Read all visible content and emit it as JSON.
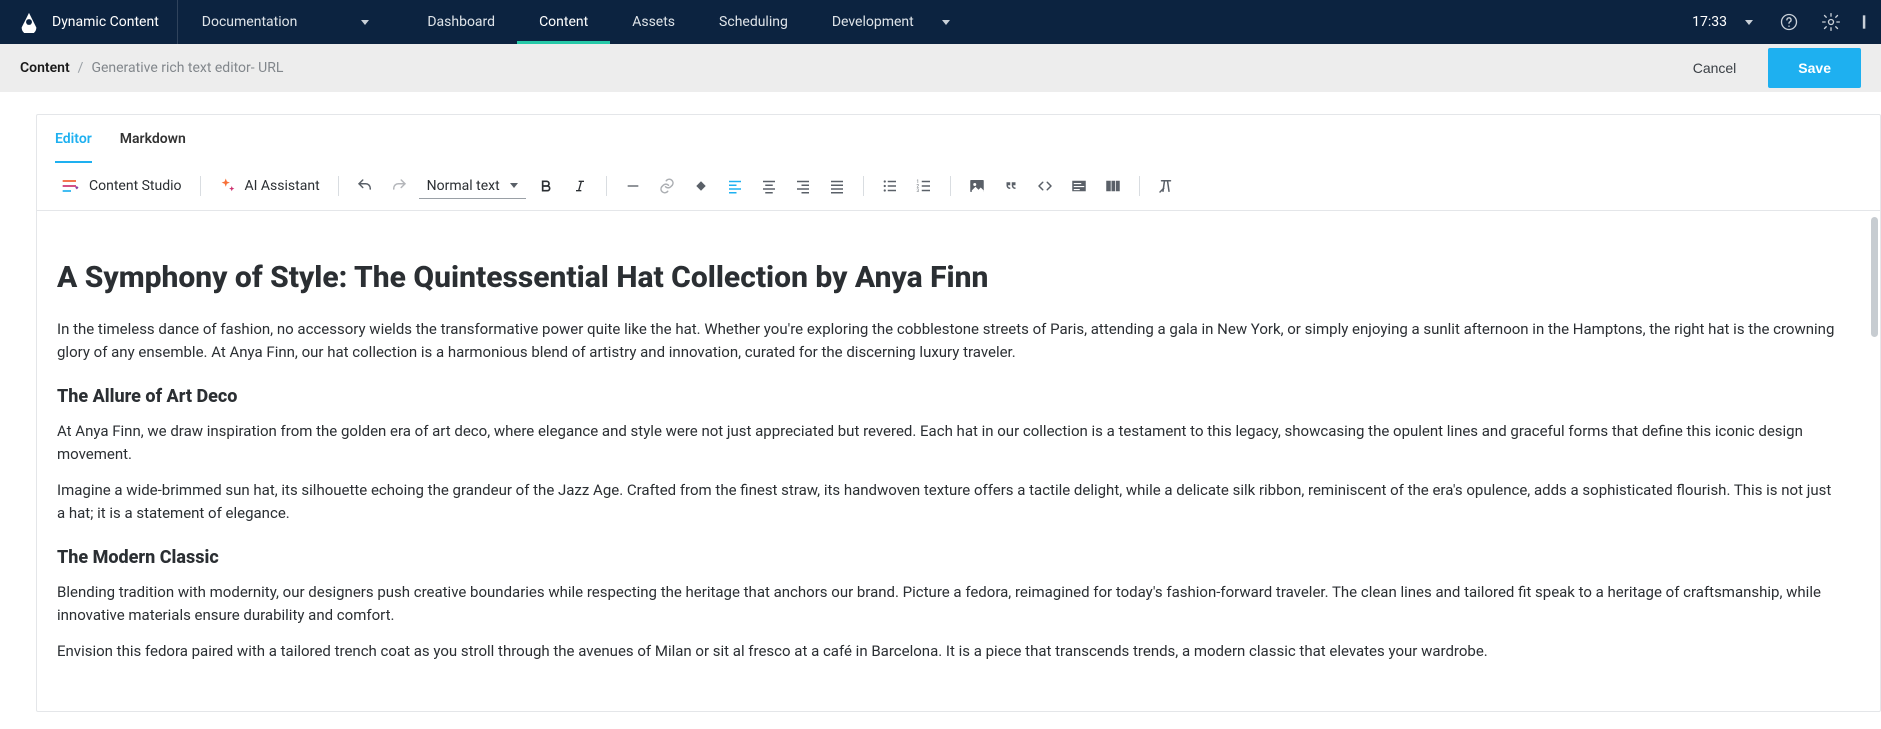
{
  "header": {
    "brand": "Dynamic Content",
    "docMenu": "Documentation",
    "tabs": [
      {
        "label": "Dashboard",
        "active": false,
        "hasCaret": false
      },
      {
        "label": "Content",
        "active": true,
        "hasCaret": false
      },
      {
        "label": "Assets",
        "active": false,
        "hasCaret": false
      },
      {
        "label": "Scheduling",
        "active": false,
        "hasCaret": false
      },
      {
        "label": "Development",
        "active": false,
        "hasCaret": true
      }
    ],
    "time": "17:33"
  },
  "breadcrumb": {
    "root": "Content",
    "leaf": "Generative rich text editor- URL",
    "cancel": "Cancel",
    "save": "Save"
  },
  "editorTabs": {
    "editor": "Editor",
    "markdown": "Markdown"
  },
  "toolbar": {
    "contentStudio": "Content Studio",
    "aiAssistant": "AI Assistant",
    "stylePicker": "Normal text"
  },
  "document": {
    "h1": "A Symphony of Style: The Quintessential Hat Collection by Anya Finn",
    "p1": "In the timeless dance of fashion, no accessory wields the transformative power quite like the hat. Whether you're exploring the cobblestone streets of Paris, attending a gala in New York, or simply enjoying a sunlit afternoon in the Hamptons, the right hat is the crowning glory of any ensemble. At Anya Finn, our hat collection is a harmonious blend of artistry and innovation, curated for the discerning luxury traveler.",
    "h2a": "The Allure of Art Deco",
    "p2": "At Anya Finn, we draw inspiration from the golden era of art deco, where elegance and style were not just appreciated but revered. Each hat in our collection is a testament to this legacy, showcasing the opulent lines and graceful forms that define this iconic design movement.",
    "p3": "Imagine a wide-brimmed sun hat, its silhouette echoing the grandeur of the Jazz Age. Crafted from the finest straw, its handwoven texture offers a tactile delight, while a delicate silk ribbon, reminiscent of the era's opulence, adds a sophisticated flourish. This is not just a hat; it is a statement of elegance.",
    "h2b": "The Modern Classic",
    "p4": "Blending tradition with modernity, our designers push creative boundaries while respecting the heritage that anchors our brand. Picture a fedora, reimagined for today's fashion-forward traveler. The clean lines and tailored fit speak to a heritage of craftsmanship, while innovative materials ensure durability and comfort.",
    "p5": "Envision this fedora paired with a tailored trench coat as you stroll through the avenues of Milan or sit al fresco at a café in Barcelona. It is a piece that transcends trends, a modern classic that elevates your wardrobe."
  }
}
